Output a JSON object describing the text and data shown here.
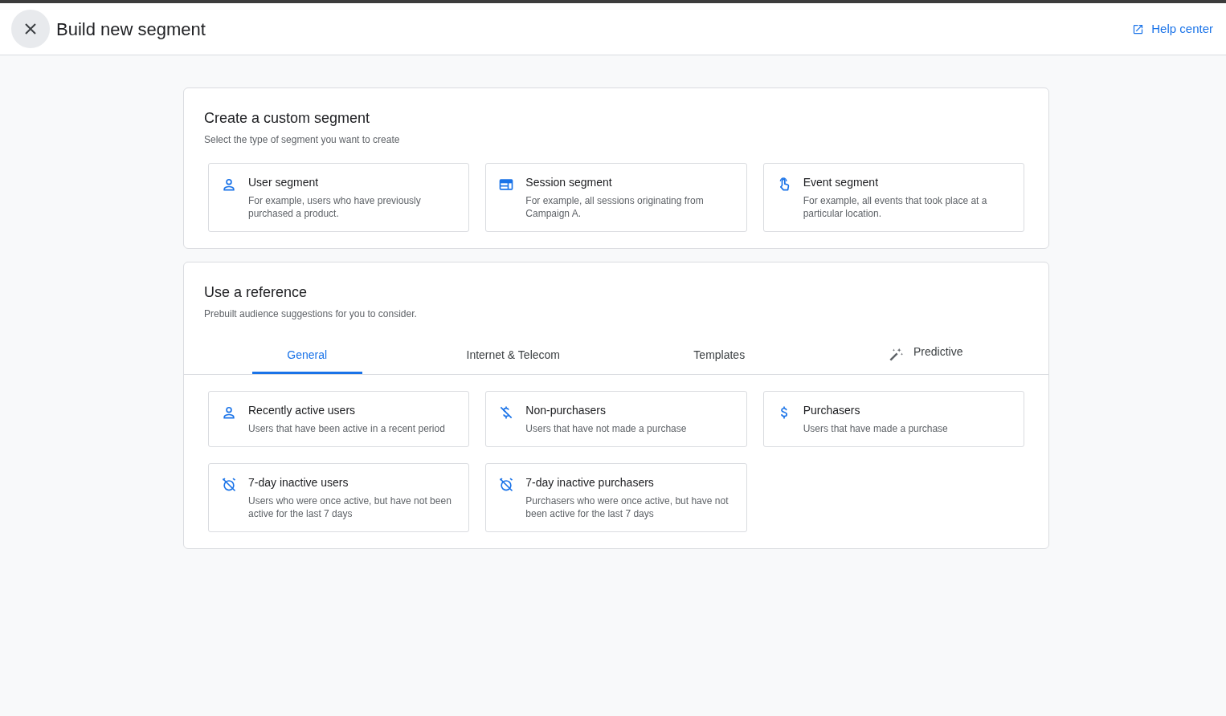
{
  "header": {
    "title": "Build new segment",
    "help_link": "Help center"
  },
  "custom_segment": {
    "title": "Create a custom segment",
    "subtitle": "Select the type of segment you want to create",
    "options": [
      {
        "kind": "user",
        "title": "User segment",
        "description": "For example, users who have previously purchased a product."
      },
      {
        "kind": "session",
        "title": "Session segment",
        "description": "For example, all sessions originating from Campaign A."
      },
      {
        "kind": "event",
        "title": "Event segment",
        "description": "For example, all events that took place at a particular location."
      }
    ]
  },
  "reference": {
    "title": "Use a reference",
    "subtitle": "Prebuilt audience suggestions for you to consider.",
    "tabs": [
      {
        "label": "General",
        "selected": true,
        "kind": "plain"
      },
      {
        "label": "Internet & Telecom",
        "selected": false,
        "kind": "plain"
      },
      {
        "label": "Templates",
        "selected": false,
        "kind": "plain"
      },
      {
        "label": "Predictive",
        "selected": false,
        "kind": "wand"
      }
    ],
    "suggestions": [
      {
        "kind": "user",
        "title": "Recently active users",
        "description": "Users that have been active in a recent period"
      },
      {
        "kind": "no-purchase",
        "title": "Non-purchasers",
        "description": "Users that have not made a purchase"
      },
      {
        "kind": "purchase",
        "title": "Purchasers",
        "description": "Users that have made a purchase"
      },
      {
        "kind": "alarm-off",
        "title": "7-day inactive users",
        "description": "Users who were once active, but have not been active for the last 7 days"
      },
      {
        "kind": "alarm-off",
        "title": "7-day inactive purchasers",
        "description": "Purchasers who were once active, but have not been active for the last 7 days"
      }
    ]
  }
}
